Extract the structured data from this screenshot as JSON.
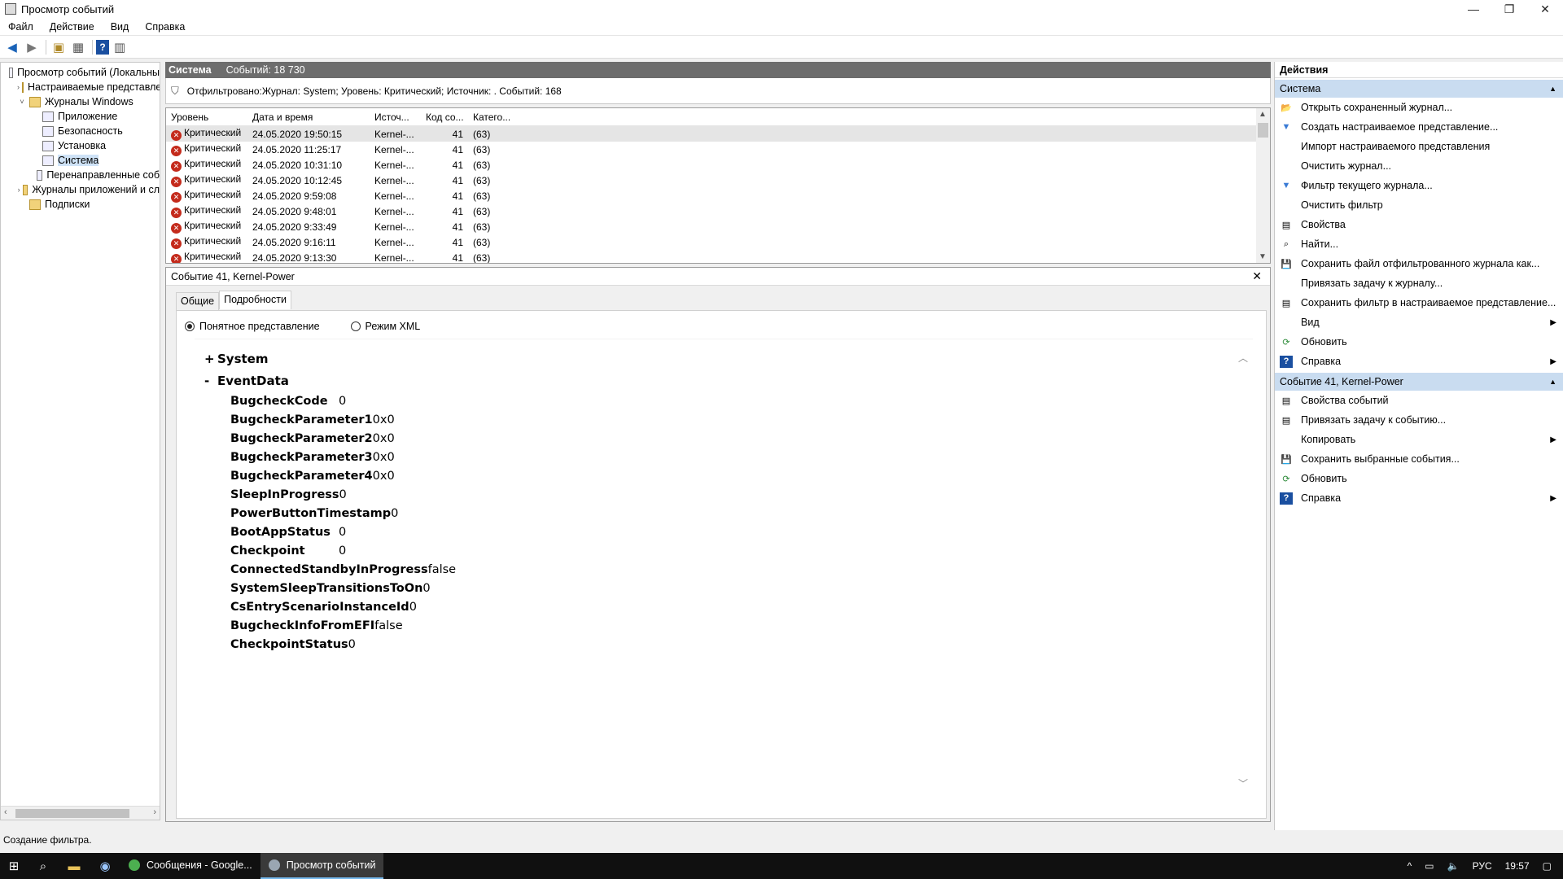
{
  "window": {
    "title": "Просмотр событий",
    "minimize": "—",
    "restore": "❐",
    "close": "✕"
  },
  "menu": [
    "Файл",
    "Действие",
    "Вид",
    "Справка"
  ],
  "tree": {
    "items": [
      {
        "label": "Просмотр событий (Локальны",
        "exp": "",
        "indent": 0,
        "folder": false
      },
      {
        "label": "Настраиваемые представле",
        "exp": "›",
        "indent": 1,
        "folder": true
      },
      {
        "label": "Журналы Windows",
        "exp": "˅",
        "indent": 1,
        "folder": true
      },
      {
        "label": "Приложение",
        "exp": "",
        "indent": 2,
        "folder": false
      },
      {
        "label": "Безопасность",
        "exp": "",
        "indent": 2,
        "folder": false
      },
      {
        "label": "Установка",
        "exp": "",
        "indent": 2,
        "folder": false
      },
      {
        "label": "Система",
        "exp": "",
        "indent": 2,
        "folder": false,
        "selected": true
      },
      {
        "label": "Перенаправленные соб",
        "exp": "",
        "indent": 2,
        "folder": false
      },
      {
        "label": "Журналы приложений и сл",
        "exp": "›",
        "indent": 1,
        "folder": true
      },
      {
        "label": "Подписки",
        "exp": "",
        "indent": 1,
        "folder": true
      }
    ]
  },
  "mid": {
    "header_name": "Система",
    "header_count": "Событий: 18 730",
    "filter_text": "Отфильтровано:Журнал: System; Уровень: Критический; Источник: . Событий: 168",
    "columns": [
      "Уровень",
      "Дата и время",
      "Источ...",
      "Код со...",
      "Катего..."
    ],
    "rows": [
      [
        "Критический",
        "24.05.2020 19:50:15",
        "Kernel-...",
        "41",
        "(63)"
      ],
      [
        "Критический",
        "24.05.2020 11:25:17",
        "Kernel-...",
        "41",
        "(63)"
      ],
      [
        "Критический",
        "24.05.2020 10:31:10",
        "Kernel-...",
        "41",
        "(63)"
      ],
      [
        "Критический",
        "24.05.2020 10:12:45",
        "Kernel-...",
        "41",
        "(63)"
      ],
      [
        "Критический",
        "24.05.2020 9:59:08",
        "Kernel-...",
        "41",
        "(63)"
      ],
      [
        "Критический",
        "24.05.2020 9:48:01",
        "Kernel-...",
        "41",
        "(63)"
      ],
      [
        "Критический",
        "24.05.2020 9:33:49",
        "Kernel-...",
        "41",
        "(63)"
      ],
      [
        "Критический",
        "24.05.2020 9:16:11",
        "Kernel-...",
        "41",
        "(63)"
      ],
      [
        "Критический",
        "24.05.2020 9:13:30",
        "Kernel-...",
        "41",
        "(63)"
      ]
    ]
  },
  "detail": {
    "title": "Событие 41, Kernel-Power",
    "close": "✕",
    "tabs": [
      "Общие",
      "Подробности"
    ],
    "radio_friendly": "Понятное представление",
    "radio_xml": "Режим XML",
    "sections": [
      {
        "pm": "+",
        "name": "System"
      },
      {
        "pm": "-",
        "name": "EventData"
      }
    ],
    "fields": [
      {
        "k": "BugcheckCode",
        "v": "0"
      },
      {
        "k": "BugcheckParameter1",
        "v": "0x0"
      },
      {
        "k": "BugcheckParameter2",
        "v": "0x0"
      },
      {
        "k": "BugcheckParameter3",
        "v": "0x0"
      },
      {
        "k": "BugcheckParameter4",
        "v": "0x0"
      },
      {
        "k": "SleepInProgress",
        "v": "0"
      },
      {
        "k": "PowerButtonTimestamp",
        "v": "0"
      },
      {
        "k": "BootAppStatus",
        "v": "0"
      },
      {
        "k": "Checkpoint",
        "v": "0"
      },
      {
        "k": "ConnectedStandbyInProgress",
        "v": "false"
      },
      {
        "k": "SystemSleepTransitionsToOn",
        "v": "0"
      },
      {
        "k": "CsEntryScenarioInstanceId",
        "v": "0"
      },
      {
        "k": "BugcheckInfoFromEFI",
        "v": "false"
      },
      {
        "k": "CheckpointStatus",
        "v": "0"
      }
    ]
  },
  "actions": {
    "title": "Действия",
    "section1": "Система",
    "items1": [
      {
        "label": "Открыть сохраненный журнал...",
        "icon": "folder-open-icon",
        "glyph": "📂",
        "sub": false
      },
      {
        "label": "Создать настраиваемое представление...",
        "icon": "filter-new-icon",
        "glyph": "▼",
        "sub": false
      },
      {
        "label": "Импорт настраиваемого представления",
        "icon": "",
        "glyph": "",
        "sub": false
      },
      {
        "label": "Очистить журнал...",
        "icon": "",
        "glyph": "",
        "sub": false
      },
      {
        "label": "Фильтр текущего журнала...",
        "icon": "filter-icon",
        "glyph": "▼",
        "sub": false
      },
      {
        "label": "Очистить фильтр",
        "icon": "",
        "glyph": "",
        "sub": false
      },
      {
        "label": "Свойства",
        "icon": "properties-icon",
        "glyph": "▤",
        "sub": false
      },
      {
        "label": "Найти...",
        "icon": "find-icon",
        "glyph": "⌕",
        "sub": false
      },
      {
        "label": "Сохранить файл отфильтрованного журнала как...",
        "icon": "save-icon",
        "glyph": "💾",
        "sub": false
      },
      {
        "label": "Привязать задачу к журналу...",
        "icon": "",
        "glyph": "",
        "sub": false
      },
      {
        "label": "Сохранить фильтр в настраиваемое представление...",
        "icon": "save-filter-icon",
        "glyph": "▤",
        "sub": false
      },
      {
        "label": "Вид",
        "icon": "",
        "glyph": "",
        "sub": true
      },
      {
        "label": "Обновить",
        "icon": "refresh-icon",
        "glyph": "⟳",
        "sub": false
      },
      {
        "label": "Справка",
        "icon": "help-icon",
        "glyph": "?",
        "sub": true
      }
    ],
    "section2": "Событие 41, Kernel-Power",
    "items2": [
      {
        "label": "Свойства событий",
        "icon": "properties-icon",
        "glyph": "▤",
        "sub": false
      },
      {
        "label": "Привязать задачу к событию...",
        "icon": "task-icon",
        "glyph": "▤",
        "sub": false
      },
      {
        "label": "Копировать",
        "icon": "",
        "glyph": "",
        "sub": true
      },
      {
        "label": "Сохранить выбранные события...",
        "icon": "save-icon",
        "glyph": "💾",
        "sub": false
      },
      {
        "label": "Обновить",
        "icon": "refresh-icon",
        "glyph": "⟳",
        "sub": false
      },
      {
        "label": "Справка",
        "icon": "help-icon",
        "glyph": "?",
        "sub": true
      }
    ]
  },
  "status": "Создание фильтра.",
  "taskbar": {
    "tasks": [
      {
        "label": "Сообщения - Google...",
        "color": "#4caf50",
        "active": false
      },
      {
        "label": "Просмотр событий",
        "color": "#9aa6b2",
        "active": true
      }
    ],
    "lang": "РУС",
    "time": "19:57"
  }
}
